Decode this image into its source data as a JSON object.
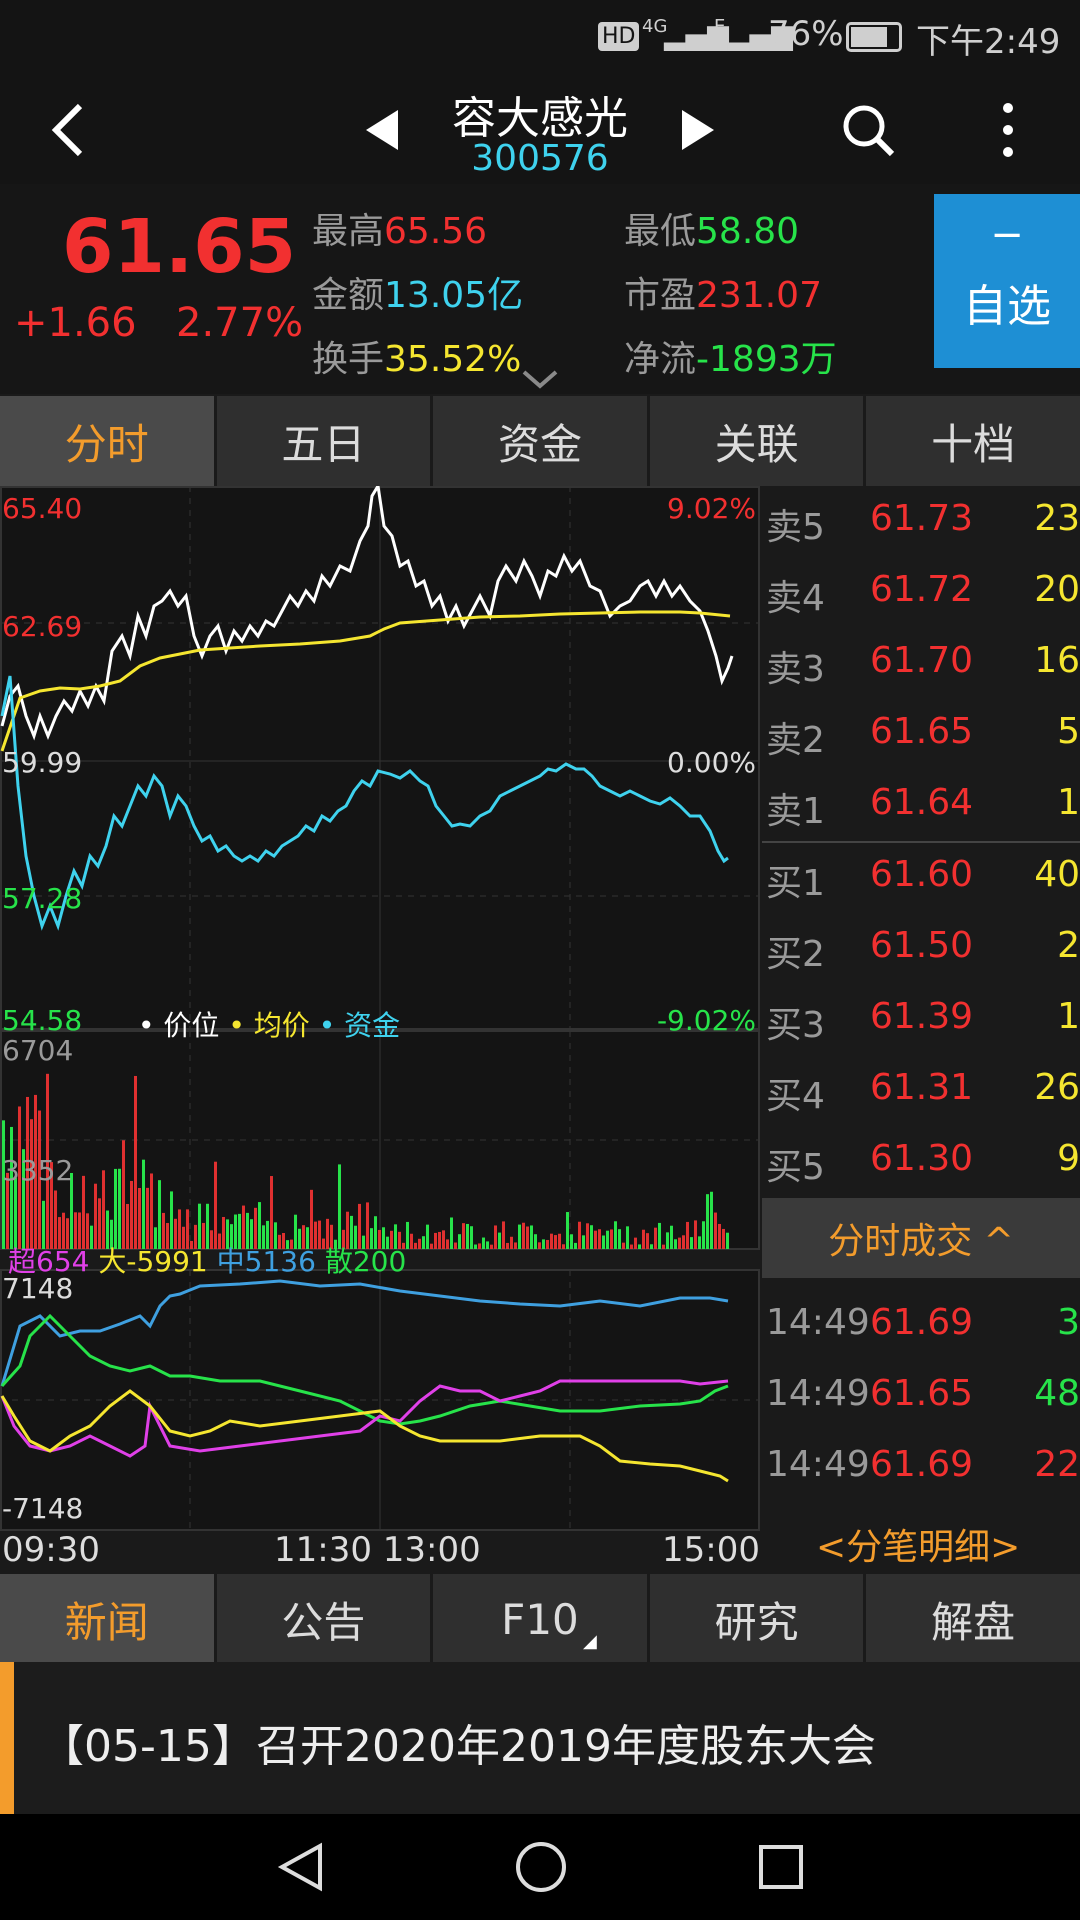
{
  "status_bar": {
    "hd": "HD",
    "signal1": "4G",
    "signal2": "E",
    "battery": "76%",
    "time": "下午2:49"
  },
  "title": {
    "name": "容大感光",
    "code": "300576"
  },
  "quote": {
    "price": "61.65",
    "change": "+1.66",
    "change_pct": "2.77%",
    "fields": [
      {
        "key": "最高",
        "value": "65.56",
        "color": "red"
      },
      {
        "key": "最低",
        "value": "58.80",
        "color": "green"
      },
      {
        "key": "金额",
        "value": "13.05亿",
        "color": "cyan"
      },
      {
        "key": "市盈",
        "value": "231.07",
        "color": "red"
      },
      {
        "key": "换手",
        "value": "35.52%",
        "color": "yellow"
      },
      {
        "key": "净流",
        "value": "-1893万",
        "color": "green"
      }
    ],
    "watch_button": {
      "icon": "−",
      "label": "自选"
    }
  },
  "chart_tabs": [
    "分时",
    "五日",
    "资金",
    "关联",
    "十档"
  ],
  "chart_tab_active": 0,
  "chart_labels": {
    "price_levels": [
      "65.40",
      "62.69",
      "59.99",
      "57.28",
      "54.58"
    ],
    "pct_levels": [
      "9.02%",
      "0.00%",
      "-9.02%"
    ],
    "legend": [
      "价位",
      "均价",
      "资金"
    ],
    "volume_levels": [
      "6704",
      "3352"
    ],
    "fund_legend": [
      {
        "text": "超654",
        "color": "#e040e8"
      },
      {
        "text": "大-5991",
        "color": "#f5e630"
      },
      {
        "text": "中5136",
        "color": "#3fa0e0"
      },
      {
        "text": "散200",
        "color": "#27e34a"
      }
    ],
    "fund_levels": [
      "7148",
      "-7148"
    ],
    "time_axis": [
      "09:30",
      "11:30 13:00",
      "15:00"
    ]
  },
  "order_book": {
    "sell": [
      {
        "label": "卖5",
        "price": "61.73",
        "vol": "23"
      },
      {
        "label": "卖4",
        "price": "61.72",
        "vol": "20"
      },
      {
        "label": "卖3",
        "price": "61.70",
        "vol": "16"
      },
      {
        "label": "卖2",
        "price": "61.65",
        "vol": "5"
      },
      {
        "label": "卖1",
        "price": "61.64",
        "vol": "1"
      }
    ],
    "buy": [
      {
        "label": "买1",
        "price": "61.60",
        "vol": "40"
      },
      {
        "label": "买2",
        "price": "61.50",
        "vol": "2"
      },
      {
        "label": "买3",
        "price": "61.39",
        "vol": "1"
      },
      {
        "label": "买4",
        "price": "61.31",
        "vol": "26"
      },
      {
        "label": "买5",
        "price": "61.30",
        "vol": "9"
      }
    ]
  },
  "ticks": {
    "header": "分时成交 ^",
    "rows": [
      {
        "time": "14:49",
        "price": "61.69",
        "vol": "3",
        "vol_color": "green"
      },
      {
        "time": "14:49",
        "price": "61.65",
        "vol": "48",
        "vol_color": "green"
      },
      {
        "time": "14:49",
        "price": "61.69",
        "vol": "22",
        "vol_color": "red"
      }
    ],
    "detail_link": "<分笔明细>"
  },
  "bottom_tabs": [
    "新闻",
    "公告",
    "F10",
    "研究",
    "解盘"
  ],
  "bottom_tab_active": 0,
  "news": {
    "date": "【05-15】",
    "title": "召开2020年2019年度股东大会"
  }
}
